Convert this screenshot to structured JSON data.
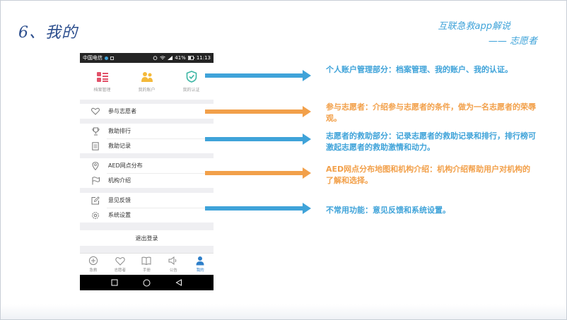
{
  "slide": {
    "title": "6、我的",
    "brand": "互联急救app解说",
    "brand_sub": "—— 志愿者"
  },
  "phone": {
    "status_bar": {
      "carrier": "中国电信",
      "battery": "41%",
      "time": "11:13"
    },
    "top_grid": [
      {
        "label": "档案管理",
        "icon": "archive-icon"
      },
      {
        "label": "我的账户",
        "icon": "user-account-icon"
      },
      {
        "label": "我的认证",
        "icon": "shield-check-icon"
      }
    ],
    "groups": [
      {
        "items": [
          {
            "label": "参与志愿者",
            "icon": "heart-outline-icon"
          }
        ]
      },
      {
        "items": [
          {
            "label": "救助排行",
            "icon": "trophy-icon"
          },
          {
            "label": "救助记录",
            "icon": "record-icon"
          }
        ]
      },
      {
        "items": [
          {
            "label": "AED网点分布",
            "icon": "location-pin-icon"
          },
          {
            "label": "机构介绍",
            "icon": "flag-icon"
          }
        ]
      },
      {
        "items": [
          {
            "label": "意见反馈",
            "icon": "edit-icon"
          },
          {
            "label": "系统设置",
            "icon": "settings-icon"
          }
        ]
      }
    ],
    "logout_label": "退出登录",
    "tabs": [
      {
        "label": "急救",
        "icon": "emergency-icon"
      },
      {
        "label": "志愿者",
        "icon": "volunteer-icon"
      },
      {
        "label": "手册",
        "icon": "book-icon"
      },
      {
        "label": "公告",
        "icon": "announcement-icon"
      },
      {
        "label": "我的",
        "icon": "person-icon"
      }
    ],
    "active_tab": "我的"
  },
  "annotations": [
    {
      "text": "个人账户管理部分：档案管理、我的账户、我的认证。",
      "color": "#3fa3d9"
    },
    {
      "text": "参与志愿者：介绍参与志愿者的条件，做为一名志愿者的荣辱观。",
      "color": "#f2a04a"
    },
    {
      "text": "志愿者的救助部分：记录志愿者的救助记录和排行，排行榜可激起志愿者的救助激情和动力。",
      "color": "#3fa3d9"
    },
    {
      "text": "AED网点分布地图和机构介绍：机构介绍帮助用户对机构的了解和选择。",
      "color": "#f2a04a"
    },
    {
      "text": "不常用功能：意见反馈和系统设置。",
      "color": "#3fa3d9"
    }
  ],
  "colors": {
    "title": "#2d4f8e",
    "accent_blue": "#3fa3d9",
    "accent_orange": "#f2a04a",
    "tab_active": "#2e7fc9",
    "badge_red": "#e2526a",
    "badge_yellow": "#f4b93a",
    "badge_teal": "#3cb6a4"
  }
}
